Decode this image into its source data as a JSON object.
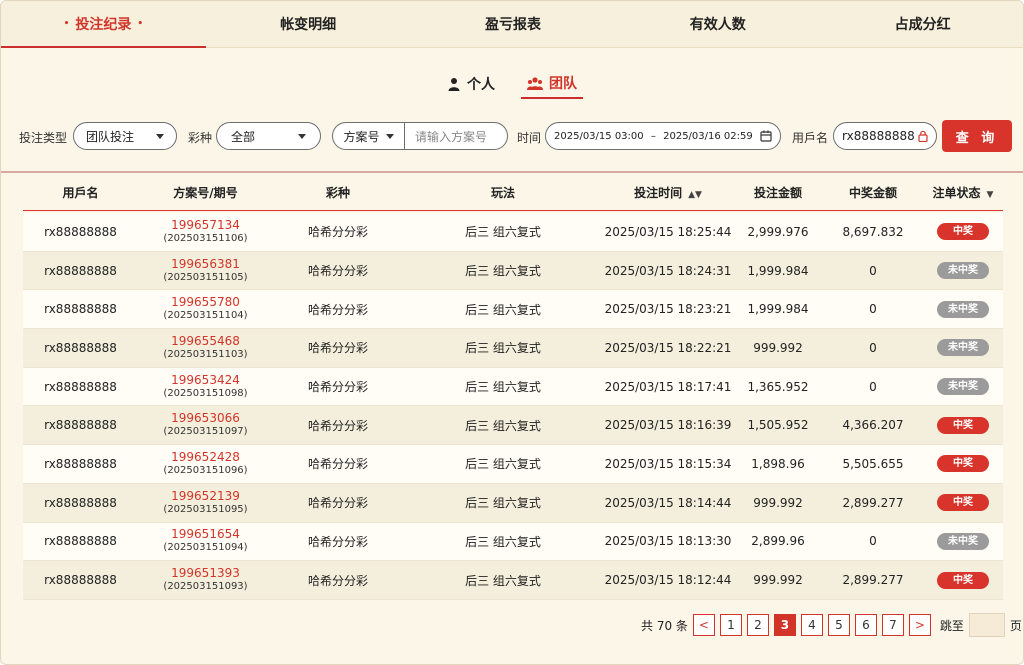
{
  "top_tabs": [
    {
      "label": "投注纪录",
      "active": true
    },
    {
      "label": "帐变明细",
      "active": false
    },
    {
      "label": "盈亏报表",
      "active": false
    },
    {
      "label": "有效人数",
      "active": false
    },
    {
      "label": "占成分红",
      "active": false
    }
  ],
  "sub_tabs": [
    {
      "label": "个人",
      "icon": "person-icon",
      "active": false
    },
    {
      "label": "团队",
      "icon": "team-icon",
      "active": true
    }
  ],
  "filters": {
    "bet_type_label": "投注类型",
    "bet_type_value": "团队投注",
    "lottery_label": "彩种",
    "lottery_value": "全部",
    "plan_select_value": "方案号",
    "plan_input_placeholder": "请输入方案号",
    "time_label": "时间",
    "time_start": "2025/03/15 03:00",
    "time_sep": "–",
    "time_end": "2025/03/16 02:59",
    "username_label": "用戶名",
    "username_value": "rx88888888",
    "query_button": "查 询"
  },
  "table": {
    "headers": [
      "用戶名",
      "方案号/期号",
      "彩种",
      "玩法",
      "投注时间",
      "投注金额",
      "中奖金额",
      "注单状态"
    ],
    "rows": [
      {
        "user": "rx88888888",
        "plan": "199657134",
        "issue": "(202503151106)",
        "lottery": "哈希分分彩",
        "play": "后三 组六复式",
        "time": "2025/03/15 18:25:44",
        "bet": "2,999.976",
        "win": "8,697.832",
        "status": "中奖"
      },
      {
        "user": "rx88888888",
        "plan": "199656381",
        "issue": "(202503151105)",
        "lottery": "哈希分分彩",
        "play": "后三 组六复式",
        "time": "2025/03/15 18:24:31",
        "bet": "1,999.984",
        "win": "0",
        "status": "未中奖"
      },
      {
        "user": "rx88888888",
        "plan": "199655780",
        "issue": "(202503151104)",
        "lottery": "哈希分分彩",
        "play": "后三 组六复式",
        "time": "2025/03/15 18:23:21",
        "bet": "1,999.984",
        "win": "0",
        "status": "未中奖"
      },
      {
        "user": "rx88888888",
        "plan": "199655468",
        "issue": "(202503151103)",
        "lottery": "哈希分分彩",
        "play": "后三 组六复式",
        "time": "2025/03/15 18:22:21",
        "bet": "999.992",
        "win": "0",
        "status": "未中奖"
      },
      {
        "user": "rx88888888",
        "plan": "199653424",
        "issue": "(202503151098)",
        "lottery": "哈希分分彩",
        "play": "后三 组六复式",
        "time": "2025/03/15 18:17:41",
        "bet": "1,365.952",
        "win": "0",
        "status": "未中奖"
      },
      {
        "user": "rx88888888",
        "plan": "199653066",
        "issue": "(202503151097)",
        "lottery": "哈希分分彩",
        "play": "后三 组六复式",
        "time": "2025/03/15 18:16:39",
        "bet": "1,505.952",
        "win": "4,366.207",
        "status": "中奖"
      },
      {
        "user": "rx88888888",
        "plan": "199652428",
        "issue": "(202503151096)",
        "lottery": "哈希分分彩",
        "play": "后三 组六复式",
        "time": "2025/03/15 18:15:34",
        "bet": "1,898.96",
        "win": "5,505.655",
        "status": "中奖"
      },
      {
        "user": "rx88888888",
        "plan": "199652139",
        "issue": "(202503151095)",
        "lottery": "哈希分分彩",
        "play": "后三 组六复式",
        "time": "2025/03/15 18:14:44",
        "bet": "999.992",
        "win": "2,899.277",
        "status": "中奖"
      },
      {
        "user": "rx88888888",
        "plan": "199651654",
        "issue": "(202503151094)",
        "lottery": "哈希分分彩",
        "play": "后三 组六复式",
        "time": "2025/03/15 18:13:30",
        "bet": "2,899.96",
        "win": "0",
        "status": "未中奖"
      },
      {
        "user": "rx88888888",
        "plan": "199651393",
        "issue": "(202503151093)",
        "lottery": "哈希分分彩",
        "play": "后三 组六复式",
        "time": "2025/03/15 18:12:44",
        "bet": "999.992",
        "win": "2,899.277",
        "status": "中奖"
      }
    ]
  },
  "pagination": {
    "total_text": "共 70 条",
    "prev": "<",
    "next": ">",
    "pages": [
      "1",
      "2",
      "3",
      "4",
      "5",
      "6",
      "7"
    ],
    "current": "3",
    "jump_label": "跳至",
    "page_unit": "页"
  },
  "colors": {
    "accent": "#d3342a",
    "background": "#fbf6e8",
    "lose_badge": "#9b9b9b"
  }
}
